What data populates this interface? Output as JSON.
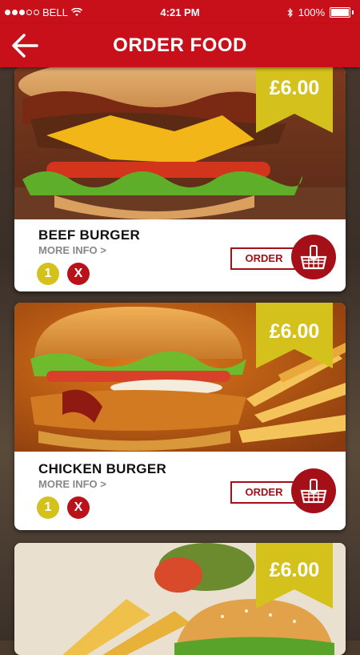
{
  "status_bar": {
    "carrier": "BELL",
    "time": "4:21 PM",
    "battery": "100%"
  },
  "nav": {
    "title": "ORDER FOOD"
  },
  "items": [
    {
      "name": "BEEF BURGER",
      "more_info": "MORE INFO >",
      "price": "£6.00",
      "quantity": "1",
      "remove": "X",
      "order_label": "ORDER"
    },
    {
      "name": "CHICKEN BURGER",
      "more_info": "MORE INFO >",
      "price": "£6.00",
      "quantity": "1",
      "remove": "X",
      "order_label": "ORDER"
    },
    {
      "price": "£6.00"
    }
  ],
  "colors": {
    "brand_red": "#c8101b",
    "ribbon_yellow": "#d4c11c",
    "dark_red": "#a50f17"
  },
  "icons": [
    "wifi-icon",
    "bluetooth-icon",
    "battery-icon",
    "back-arrow-icon",
    "basket-icon"
  ]
}
